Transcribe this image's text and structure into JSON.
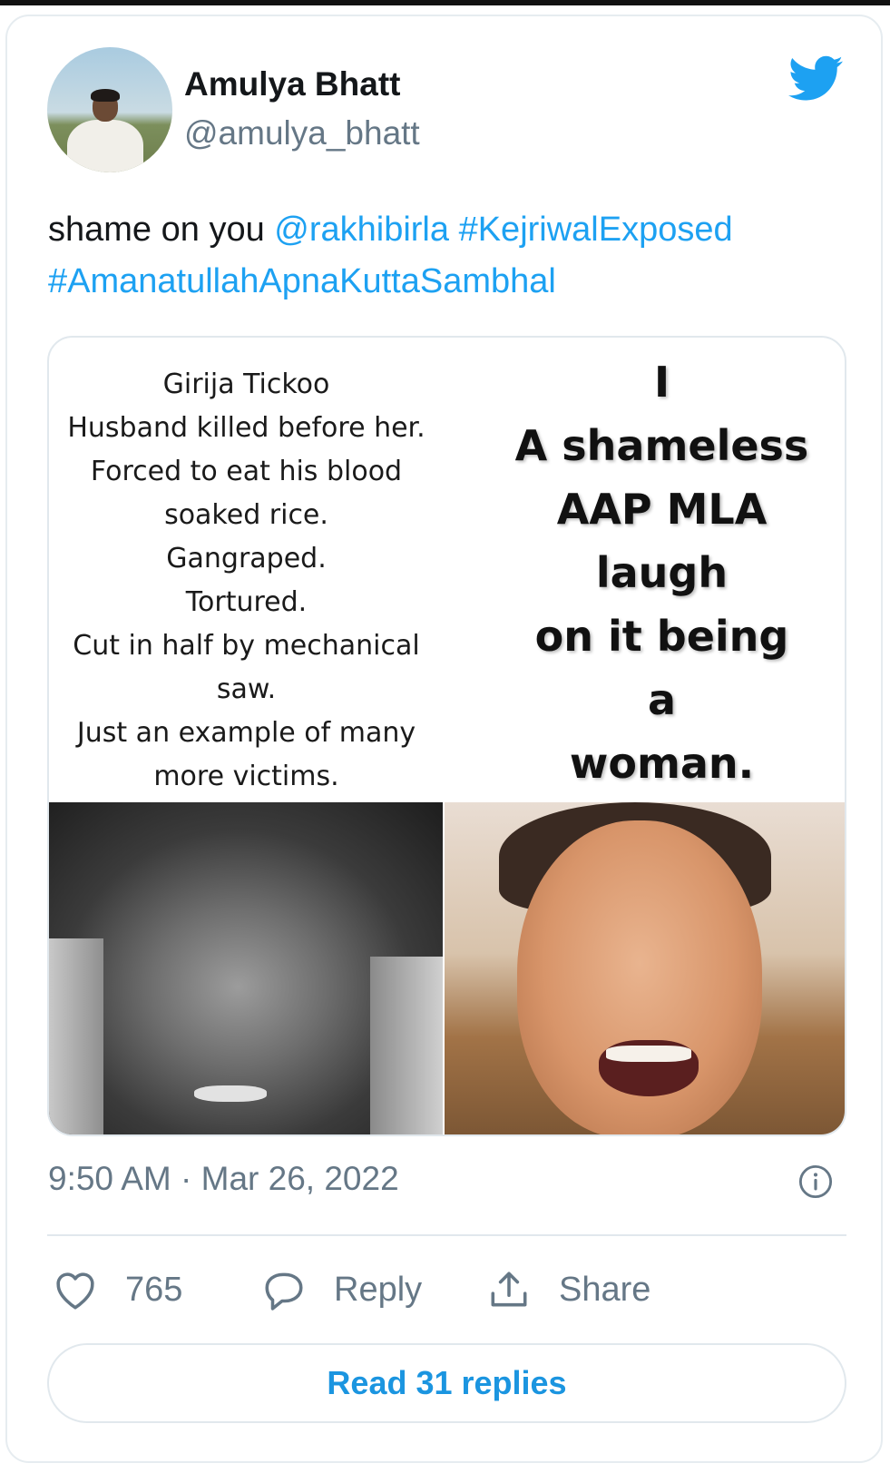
{
  "tweet": {
    "author_name": "Amulya Bhatt",
    "author_handle": "@amulya_bhatt",
    "text_plain": "shame on you ",
    "mention": "@rakhibirla",
    "hashtag1": "#KejriwalExposed",
    "hashtag2": "#AmanatullahApnaKuttaSambhal",
    "timestamp": "9:50 AM · Mar 26, 2022"
  },
  "media": {
    "left_lines": [
      "Girija Tickoo",
      "Husband killed before her.",
      "Forced to eat his blood",
      "soaked rice.",
      "Gangraped.",
      "Tortured.",
      "Cut in half by mechanical",
      "saw.",
      "Just an example of many",
      "more victims."
    ],
    "right_lines": [
      "I",
      "A shameless",
      "AAP MLA",
      "laugh",
      "on it being",
      "a",
      "woman."
    ]
  },
  "actions": {
    "likes": "765",
    "reply_label": "Reply",
    "share_label": "Share",
    "read_replies": "Read 31 replies"
  },
  "icons": {
    "bird": "twitter-bird-icon",
    "info": "info-icon",
    "like": "heart-icon",
    "reply": "comment-icon",
    "share": "share-icon"
  },
  "colors": {
    "link": "#1da1f2",
    "secondary_text": "#657786",
    "border": "#e1e8ed"
  }
}
